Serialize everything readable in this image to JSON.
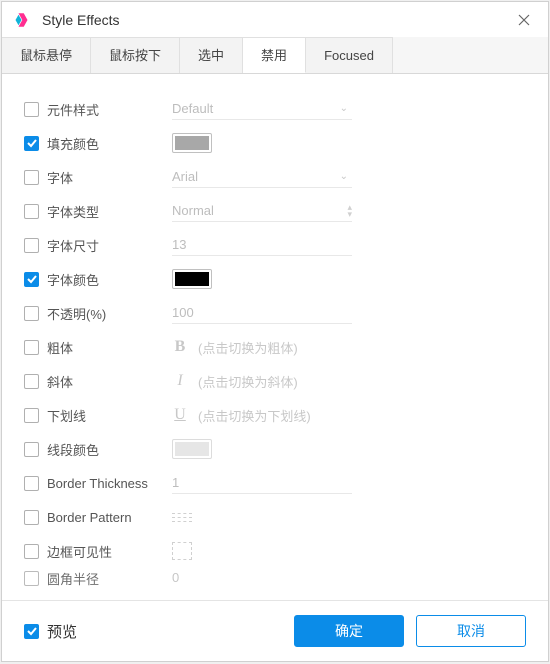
{
  "window": {
    "title": "Style Effects"
  },
  "tabs": [
    "鼠标悬停",
    "鼠标按下",
    "选中",
    "禁用",
    "Focused"
  ],
  "active_tab_index": 3,
  "props": {
    "element_style": {
      "label": "元件样式",
      "checked": false,
      "value": "Default"
    },
    "fill_color": {
      "label": "填充颜色",
      "checked": true,
      "value": "#a8a8a8"
    },
    "font": {
      "label": "字体",
      "checked": false,
      "value": "Arial"
    },
    "font_type": {
      "label": "字体类型",
      "checked": false,
      "value": "Normal"
    },
    "font_size": {
      "label": "字体尺寸",
      "checked": false,
      "value": "13"
    },
    "font_color": {
      "label": "字体颜色",
      "checked": true,
      "value": "#000000"
    },
    "opacity": {
      "label": "不透明(%)",
      "checked": false,
      "value": "100"
    },
    "bold": {
      "label": "粗体",
      "checked": false,
      "hint": "(点击切换为粗体)"
    },
    "italic": {
      "label": "斜体",
      "checked": false,
      "hint": "(点击切换为斜体)"
    },
    "underline": {
      "label": "下划线",
      "checked": false,
      "hint": "(点击切换为下划线)"
    },
    "line_color": {
      "label": "线段颜色",
      "checked": false,
      "value": "#e6e6e6"
    },
    "border_thick": {
      "label": "Border Thickness",
      "checked": false,
      "value": "1"
    },
    "border_pattern": {
      "label": "Border Pattern",
      "checked": false
    },
    "border_vis": {
      "label": "边框可见性",
      "checked": false
    },
    "corner": {
      "label": "圆角半径",
      "checked": false,
      "value": "0"
    }
  },
  "footer": {
    "preview": {
      "label": "预览",
      "checked": true
    },
    "ok": "确定",
    "cancel": "取消"
  }
}
